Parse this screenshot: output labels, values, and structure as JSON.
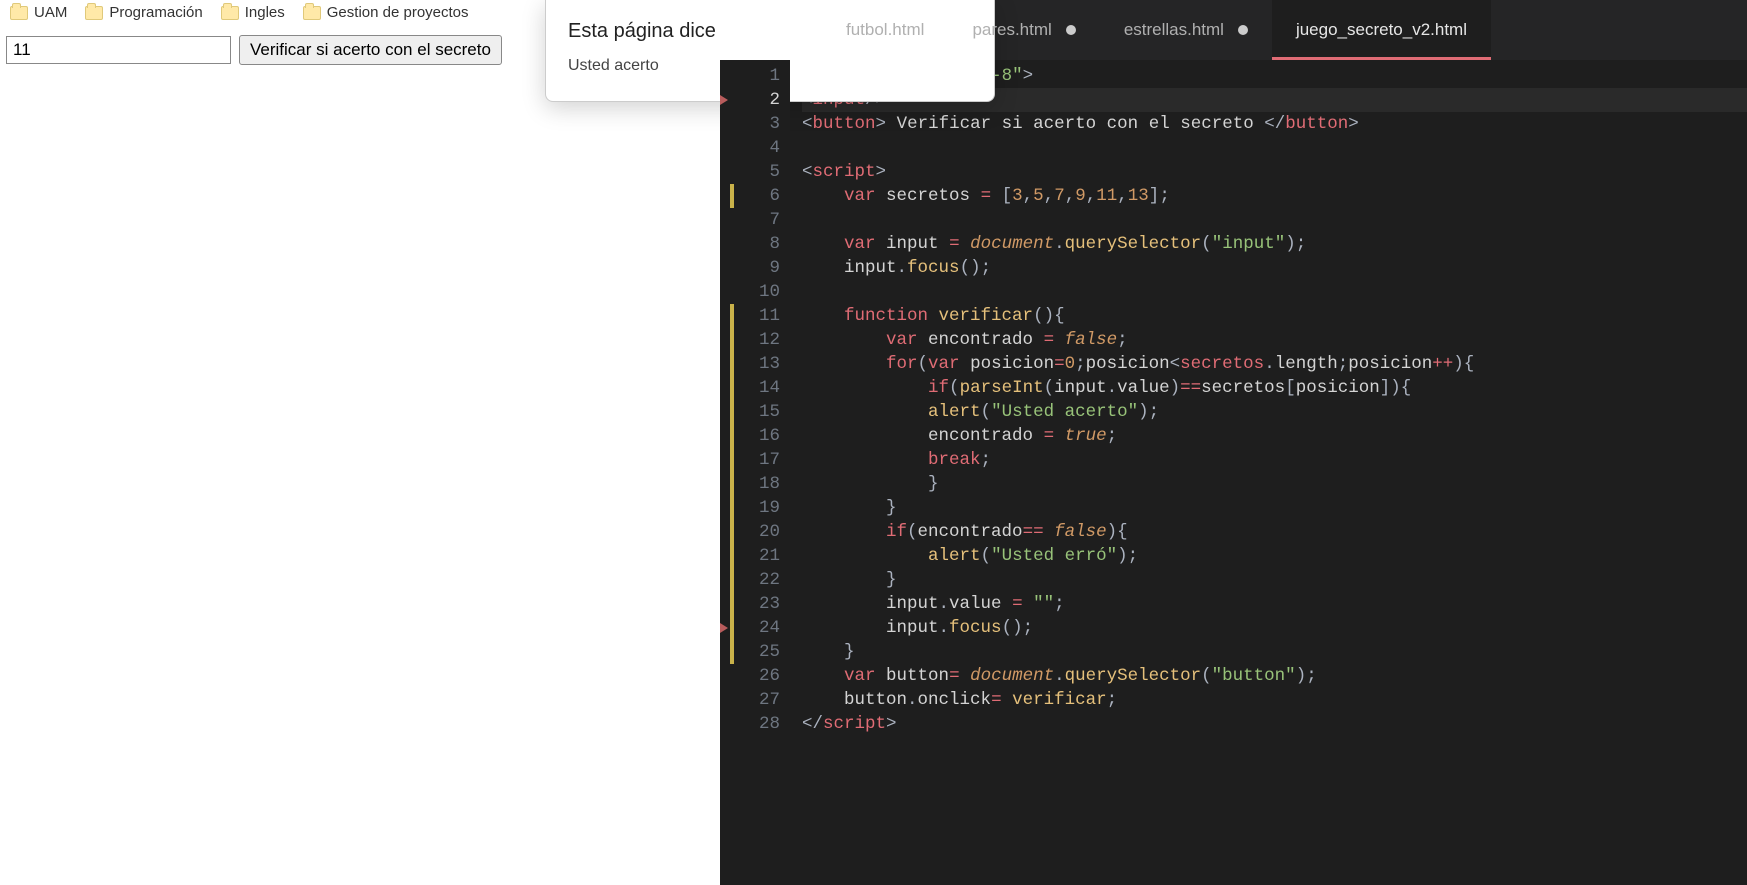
{
  "bookmarks": {
    "items": [
      "UAM",
      "Programación",
      "Ingles",
      "Gestion de proyectos"
    ]
  },
  "page": {
    "input_value": "11",
    "verify_label": "Verificar si acerto con el secreto"
  },
  "alert": {
    "title": "Esta página dice",
    "message": "Usted acerto"
  },
  "editor": {
    "nav": {
      "back": "‹",
      "forward": "›"
    },
    "tabs": [
      {
        "label": "futbol.html",
        "modified": false,
        "active": false
      },
      {
        "label": "pares.html",
        "modified": true,
        "active": false
      },
      {
        "label": "estrellas.html",
        "modified": true,
        "active": false
      },
      {
        "label": "juego_secreto_v2.html",
        "modified": false,
        "active": true
      }
    ],
    "line_count": 28,
    "current_line": 2,
    "modified_ranges": [
      {
        "start": 6,
        "end": 6
      },
      {
        "start": 11,
        "end": 25
      }
    ],
    "error_marks": [
      2,
      24
    ],
    "code_lines": [
      "<meta charset=\"UTF-8\">",
      "<input/>",
      "<button> Verificar si acerto con el secreto </button>",
      "",
      "<script>",
      "    var secretos = [3,5,7,9,11,13];",
      "",
      "    var input = document.querySelector(\"input\");",
      "    input.focus();",
      "",
      "    function verificar(){",
      "        var encontrado = false;",
      "        for(var posicion=0;posicion<secretos.length;posicion++){",
      "            if(parseInt(input.value)==secretos[posicion]){",
      "            alert(\"Usted acerto\");",
      "            encontrado = true;",
      "            break;",
      "            }",
      "        }",
      "        if(encontrado== false){",
      "            alert(\"Usted erró\");",
      "        }",
      "        input.value = \"\";",
      "        input.focus();",
      "    }",
      "    var button= document.querySelector(\"button\");",
      "    button.onclick= verificar;",
      "</script>"
    ]
  }
}
